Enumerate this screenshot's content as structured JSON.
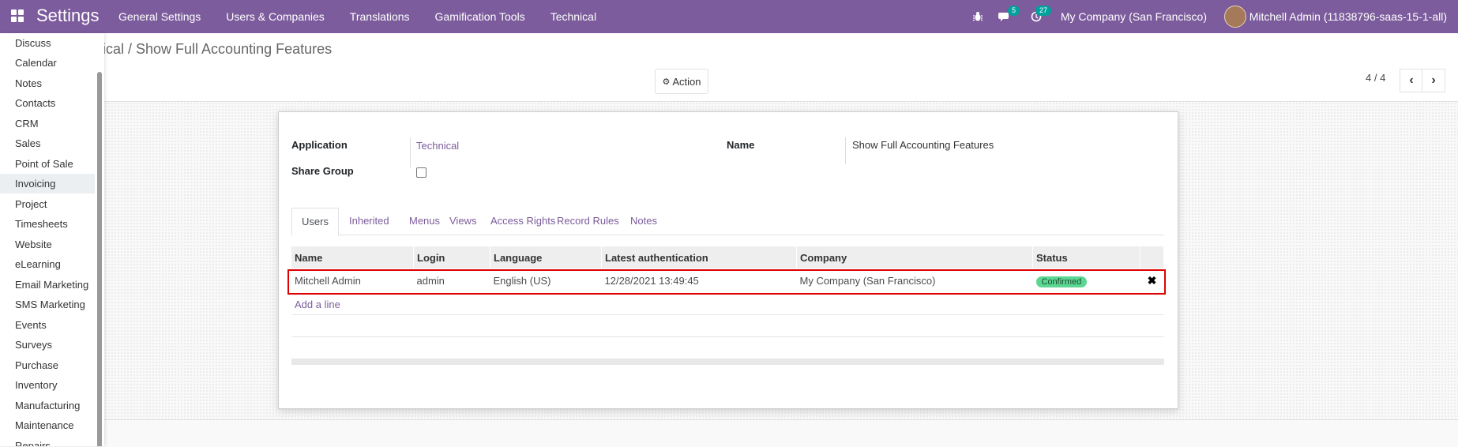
{
  "navbar": {
    "brand": "Settings",
    "menu": [
      "General Settings",
      "Users & Companies",
      "Translations",
      "Gamification Tools",
      "Technical"
    ],
    "messages_count": "5",
    "activities_count": "27",
    "company": "My Company (San Francisco)",
    "user": "Mitchell Admin (11838796-saas-15-1-all)"
  },
  "controlpanel": {
    "breadcrumb": "ical / Show Full Accounting Features",
    "action_label": "Action",
    "pager": "4 / 4"
  },
  "form": {
    "application_label": "Application",
    "application_value": "Technical",
    "share_group_label": "Share Group",
    "name_label": "Name",
    "name_value": "Show Full Accounting Features",
    "tabs": [
      "Users",
      "Inherited",
      "Menus",
      "Views",
      "Access Rights",
      "Record Rules",
      "Notes"
    ],
    "columns": [
      "Name",
      "Login",
      "Language",
      "Latest authentication",
      "Company",
      "Status"
    ],
    "rows": [
      {
        "name": "Mitchell Admin",
        "login": "admin",
        "language": "English (US)",
        "latest_auth": "12/28/2021 13:49:45",
        "company": "My Company (San Francisco)",
        "status": "Confirmed"
      }
    ],
    "add_line": "Add a line"
  },
  "app_menu": [
    "Discuss",
    "Calendar",
    "Notes",
    "Contacts",
    "CRM",
    "Sales",
    "Point of Sale",
    "Invoicing",
    "Project",
    "Timesheets",
    "Website",
    "eLearning",
    "Email Marketing",
    "SMS Marketing",
    "Events",
    "Surveys",
    "Purchase",
    "Inventory",
    "Manufacturing",
    "Maintenance",
    "Repairs"
  ],
  "app_menu_selected": "Invoicing",
  "colors": {
    "brand": "#7c5c9c",
    "status_badge": "#5cd692",
    "highlight": "#e00000"
  }
}
